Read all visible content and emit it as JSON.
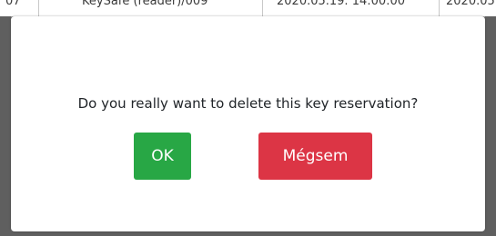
{
  "background_table": {
    "row": {
      "col1": "07",
      "col2": "KeySafe (reader)/009",
      "col3": "2020.05.19. 14:00:00",
      "col4": "2020.05"
    }
  },
  "dialog": {
    "message": "Do you really want to delete this key reservation?",
    "ok_label": "OK",
    "cancel_label": "Mégsem"
  },
  "colors": {
    "ok_button": "#28a745",
    "cancel_button": "#dc3545",
    "overlay": "#6c6c6c"
  }
}
